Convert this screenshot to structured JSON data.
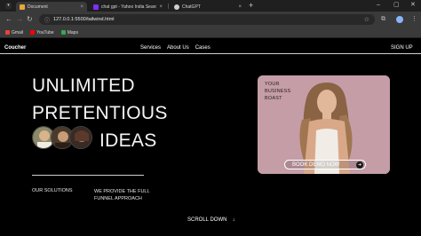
{
  "browser": {
    "tabs": [
      {
        "title": "Document",
        "active": true,
        "favicon_color": "#e8a73a"
      },
      {
        "title": "chat gpt - Yahoo India Search r",
        "active": false,
        "favicon_color": "#7b2ff7"
      },
      {
        "title": "ChatGPT",
        "active": false,
        "favicon_color": "#cfcfcf"
      }
    ],
    "new_tab_symbol": "+",
    "url": "127.0.0.1:5500/tailwind.html",
    "bookmarks": [
      {
        "label": "Gmail",
        "icon": "gmail-icon",
        "color": "#ea4335"
      },
      {
        "label": "YouTube",
        "icon": "youtube-icon",
        "color": "#ff0000"
      },
      {
        "label": "Maps",
        "icon": "maps-icon",
        "color": "#34a853"
      }
    ]
  },
  "site": {
    "brand": "Coucher",
    "nav": [
      "Services",
      "About Us",
      "Cases"
    ],
    "signup": "SIGN UP"
  },
  "hero": {
    "line1": "UNLIMITED",
    "line2": "PRETENTIOUS",
    "line3": "IDEAS",
    "solutions": "OUR SOLUTIONS",
    "full_funnel": "WE PROVIDE THE FULL FUNNEL APPROACH",
    "scroll": "SCROLL DOWN",
    "scroll_icon": "arrow-down-icon"
  },
  "card": {
    "text": "YOUR BUSINESS BOAST",
    "cta": "BOOK DEMO NOW",
    "background": "#c49da6"
  }
}
